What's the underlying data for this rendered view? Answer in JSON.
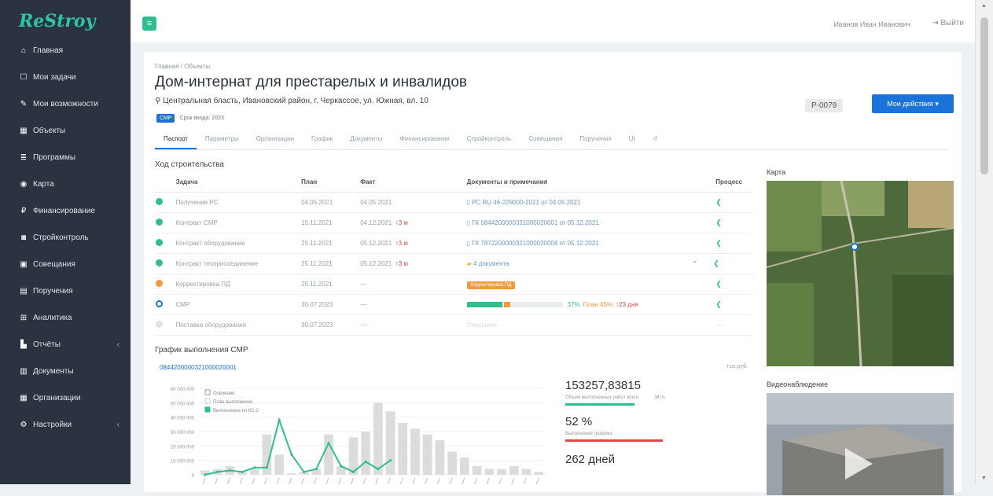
{
  "app": {
    "logo": "ReStroy"
  },
  "sidebar": {
    "items": [
      {
        "label": "Главная",
        "icon": "home-icon",
        "glyph": "⌂"
      },
      {
        "label": "Мои задачи",
        "icon": "task-icon",
        "glyph": "☐"
      },
      {
        "label": "Мои возможности",
        "icon": "pencil-icon",
        "glyph": "✎"
      },
      {
        "label": "Объекты",
        "icon": "building-icon",
        "glyph": "▦"
      },
      {
        "label": "Программы",
        "icon": "list-icon",
        "glyph": "≣"
      },
      {
        "label": "Карта",
        "icon": "map-icon",
        "glyph": "◉"
      },
      {
        "label": "Финансирование",
        "icon": "finance-icon",
        "glyph": "₽"
      },
      {
        "label": "Стройконтроль",
        "icon": "car-icon",
        "glyph": "◙"
      },
      {
        "label": "Совещания",
        "icon": "meeting-icon",
        "glyph": "▣"
      },
      {
        "label": "Поручения",
        "icon": "orders-icon",
        "glyph": "▤"
      },
      {
        "label": "Аналитика",
        "icon": "analytics-icon",
        "glyph": "⊞"
      },
      {
        "label": "Отчёты",
        "icon": "reports-icon",
        "glyph": "▙",
        "caret": "‹"
      },
      {
        "label": "Документы",
        "icon": "documents-icon",
        "glyph": "▥"
      },
      {
        "label": "Организации",
        "icon": "org-icon",
        "glyph": "▦"
      },
      {
        "label": "Настройки",
        "icon": "settings-icon",
        "glyph": "⚙",
        "caret": "‹"
      }
    ]
  },
  "topbar": {
    "user": "Иванов Иван Иванович",
    "logout": "Выйти"
  },
  "object": {
    "breadcrumb": "Главная / Объекты",
    "title": "Дом-интернат для престарелых и инвалидов",
    "address": "Центральная бласть, Ивановский район, г. Черкассое, ул. Южная, вл. 10",
    "type_badge": "СМР",
    "year_tag": "Срок ввода: 2023",
    "code": "P-0079",
    "actions_button": "Мои действия"
  },
  "tabs": [
    "Паспорт",
    "Параметры",
    "Организации",
    "График",
    "Документы",
    "Финансирование",
    "Стройконтроль",
    "Совещания",
    "Поручения",
    "Ut"
  ],
  "progress": {
    "title": "Ход строительства",
    "headers": [
      "Задача",
      "План",
      "Факт",
      "Документы и примечания",
      "Процесс"
    ],
    "rows": [
      {
        "status": "green",
        "task": "Получение РС",
        "plan": "04.05.2021",
        "fact": "04.05.2021",
        "late": "",
        "doc": "РС RU 46-229000-2021 от 04.05.2021",
        "docs": "link"
      },
      {
        "status": "green",
        "task": "Контракт СМР",
        "plan": "15.11.2021",
        "fact": "04.12.2021",
        "late": "3 м",
        "doc": "ГК 0844200000321000020001 от 05.12.2021",
        "docs": "link"
      },
      {
        "status": "green",
        "task": "Контракт оборудование",
        "plan": "25.11.2021",
        "fact": "05.12.2021",
        "late": "3 м",
        "doc": "ГК 7872200000321000020004 от 05.12.2021",
        "docs": "link"
      },
      {
        "status": "green",
        "task": "Контракт техприсоединение",
        "plan": "25.11.2021",
        "fact": "05.12.2021",
        "late": "3 м",
        "doc": "4 документа",
        "docs": "folder"
      },
      {
        "status": "orange",
        "task": "Корректировка ПД",
        "plan": "25.11.2021",
        "fact": "—",
        "late": "",
        "doc": "Корректировка ПД",
        "docs": "chip"
      },
      {
        "status": "blue",
        "task": "СМР",
        "plan": "30.07.2023",
        "fact": "—",
        "late": "",
        "doc": "",
        "docs": "bar",
        "progress": 0.37,
        "plan_progress": 0.45,
        "pct": "37%",
        "plan_pct": "План 45%",
        "delay": "23 дня"
      },
      {
        "status": "gray",
        "task": "Поставка оборудования",
        "plan": "30.07.2023",
        "fact": "—",
        "late": "",
        "doc": "Ожидание",
        "docs": "muted"
      }
    ]
  },
  "schedule": {
    "title": "График выполнения СМР",
    "contract": "0844200000321000020001",
    "units": "тыс.руб.",
    "legend": [
      "Освоение",
      "План выполнения",
      "Выполнение по КС-2"
    ]
  },
  "chart_data": {
    "type": "bar",
    "ylim": [
      0,
      60000000
    ],
    "yticks": [
      "60 000 000",
      "50 000 000",
      "40 000 000",
      "30 000 000",
      "20 000 000",
      "10 000 000",
      "0"
    ],
    "series": [
      {
        "name": "Освоение",
        "type": "bar",
        "values": [
          3000000,
          4000000,
          6000000,
          2000000,
          4000000,
          28000000,
          14000000,
          1000000,
          2000000,
          4000000,
          28000000,
          6000000,
          26000000,
          30000000,
          50000000,
          44000000,
          36000000,
          32000000,
          28000000,
          24000000,
          16000000,
          12000000,
          6000000,
          4000000,
          4000000,
          6000000,
          4000000,
          2000000
        ]
      },
      {
        "name": "Выполнение по КС-2",
        "type": "line",
        "values": [
          0,
          2000000,
          3000000,
          2000000,
          5000000,
          5000000,
          38000000,
          14000000,
          2000000,
          4000000,
          22000000,
          6000000,
          2000000,
          9000000,
          4000000,
          10000000
        ]
      }
    ]
  },
  "stats": [
    {
      "value": "153257,83815",
      "label": "Объем выполненных работ всего",
      "extra": "34 %",
      "color": "#2fbf8f"
    },
    {
      "value": "52 %",
      "label": "Выполнение графика",
      "extra": "",
      "color": "#e04848"
    },
    {
      "value": "262 дней",
      "label": "",
      "extra": "",
      "color": "#2fbf8f"
    }
  ],
  "map": {
    "title": "Карта"
  },
  "video": {
    "title": "Видеонаблюдение"
  }
}
